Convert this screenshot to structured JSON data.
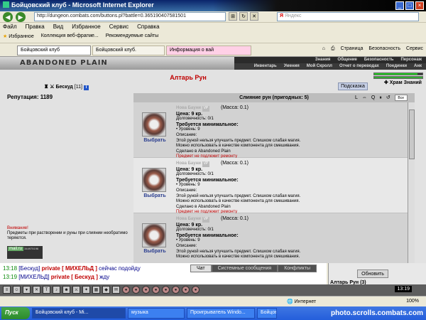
{
  "window": {
    "title": "Бойцовский клуб - Microsoft Internet Explorer"
  },
  "address": {
    "url": "http://dungeon.combats.com/buttons.pl?battle=0.365190407581501",
    "search_placeholder": "Яндекс"
  },
  "menu": [
    "Файл",
    "Правка",
    "Вид",
    "Избранное",
    "Сервис",
    "Справка"
  ],
  "favorites": {
    "label": "Избранное",
    "items": [
      "Коллекция веб-фрагме...",
      "Рекомендуемые сайты"
    ]
  },
  "tabs": [
    "Бойцовский клуб",
    "Бойцовский клуб.",
    "Информация о вай"
  ],
  "tab_tools": [
    "Страница",
    "Безопасность",
    "Сервис"
  ],
  "game": {
    "logo": "ABANDONED PLAIN",
    "nav_top": [
      "Знания",
      "Общение",
      "Безопасность",
      "Персонаж"
    ],
    "nav_bottom": [
      "Инвентарь",
      "Умения",
      "Мой Скролл",
      "Отчет о переводах",
      "Поединки",
      "Анк"
    ]
  },
  "page": {
    "title": "Алтарь Рун",
    "hint_button": "Подсказка",
    "location": "Храм Знаний",
    "player_name": "Бескуд",
    "player_level": "[11]",
    "reputation": "Репутация: 1189",
    "warning_title": "Внимание!",
    "warning_text": "Предметы при растворении и руны при слиянии необратимо теряются.",
    "counter_label": "mail.ru",
    "counter_value": "344975196"
  },
  "panel": {
    "header": "Слияние рун (пригодных: 5)",
    "sort": "Все",
    "icon_labels": [
      "L",
      "⇔",
      "Q",
      "⏸",
      "↺"
    ]
  },
  "items": [
    {
      "name": "Нова Бауни",
      "badge": "VP",
      "mass": "(Масса: 0.1)",
      "price": "Цена: 9 кр.",
      "durability": "Долговечность: 0/1",
      "requires": "Требуется минимальное:",
      "level": "• Уровень: 9",
      "desc_label": "Описание:",
      "desc": "Этой руной нельзя улучшить предмет. Слишком слабая магия.",
      "desc2": "Можно использовать в качестве компонента для смешивания.",
      "made": "Сделано в Abandoned Plain",
      "repair": "Предмет не подлежит ремонту",
      "select": "Выбрать"
    },
    {
      "name": "Нова Бауни",
      "badge": "VP",
      "mass": "(Масса: 0.1)",
      "price": "Цена: 9 кр.",
      "durability": "Долговечность: 0/1",
      "requires": "Требуется минимальное:",
      "level": "• Уровень: 9",
      "desc_label": "Описание:",
      "desc": "Этой руной нельзя улучшить предмет. Слишком слабая магия.",
      "desc2": "Можно использовать в качестве компонента для смешивания.",
      "made": "Сделано в Abandoned Plain",
      "repair": "Предмет не подлежит ремонту",
      "select": "Выбрать"
    },
    {
      "name": "Нова Бауни",
      "badge": "VP",
      "mass": "(Масса: 0.1)",
      "price": "Цена: 9 кр.",
      "durability": "Долговечность: 0/1",
      "requires": "Требуется минимальное:",
      "level": "• Уровень: 9",
      "desc_label": "Описание:",
      "desc": "Этой руной нельзя улучшить предмет. Слишком слабая магия.",
      "desc2": "Можно использовать в качестве компонента для смешивания.",
      "made": "",
      "repair": "",
      "select": "Выбрать"
    }
  ],
  "chat": {
    "tabs": [
      "Чат",
      "Системные сообщения",
      "Конфликты"
    ],
    "lines": [
      {
        "time": "13:18",
        "user": "[Бескуд]",
        "type": "private",
        "target": "[ МИХЕЛЬД ]",
        "text": "сейчас подойду"
      },
      {
        "time": "13:19",
        "user": "[МИХЕЛЬД]",
        "type": "private",
        "target": "[ Бескуд ]",
        "text": "жду"
      }
    ]
  },
  "side": {
    "refresh": "Обновить",
    "altar": "Алтарь Рун (3)"
  },
  "toolbar": {
    "clock": "13:19"
  },
  "iestatus": {
    "zone": "Интернет",
    "zoom": "100%"
  },
  "taskbar": {
    "start": "Пуск",
    "buttons": [
      "Бойцовский клуб - Mi...",
      "музыка",
      "Проигрыватель Windo...",
      "Бойцовский клуб..."
    ],
    "watermark": "photo.scrolls.combats.com"
  },
  "colors": {
    "accent": "#c00000",
    "link": "#2a3d8f",
    "chat_time": "#0a8a0a"
  }
}
